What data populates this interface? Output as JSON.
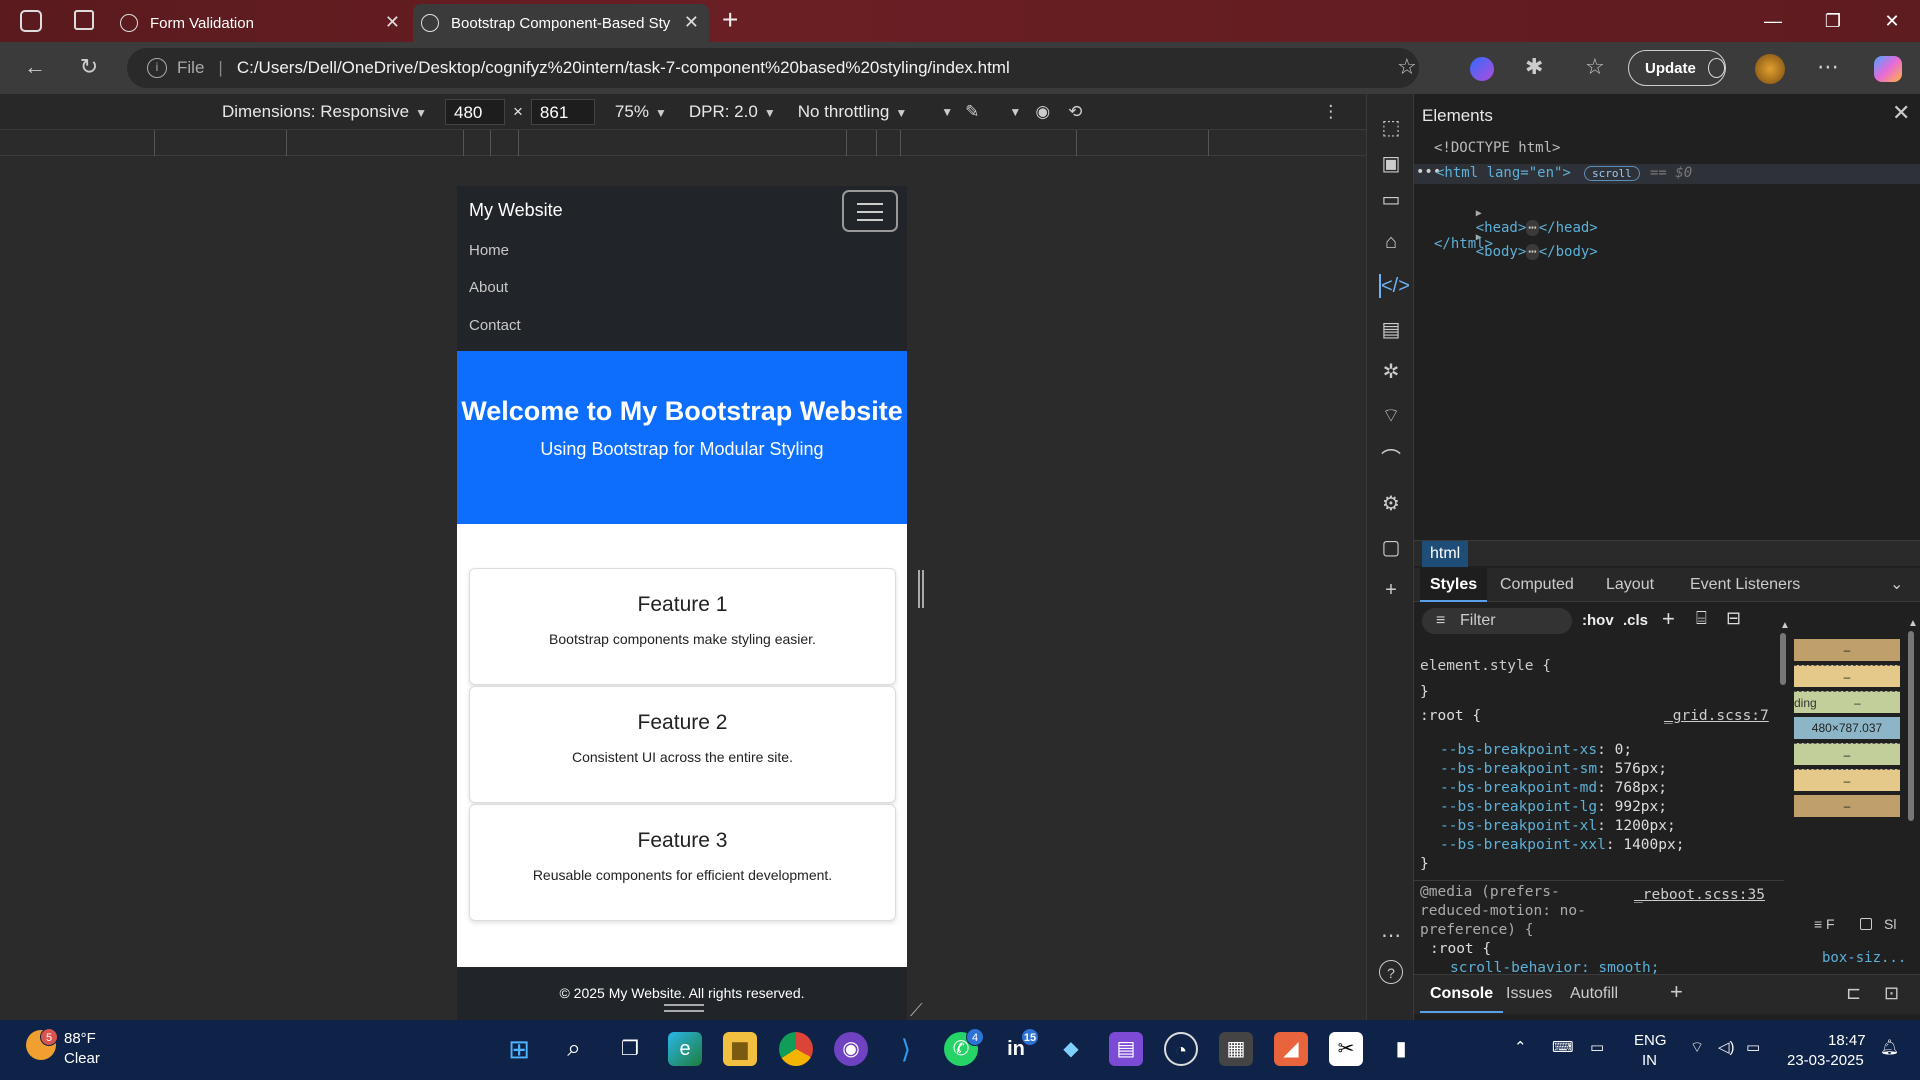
{
  "browser": {
    "tabs": [
      {
        "title": "Form Validation"
      },
      {
        "title": "Bootstrap Component-Based Styli"
      }
    ],
    "address": {
      "scheme_label": "File",
      "url": "C:/Users/Dell/OneDrive/Desktop/cognifyz%20intern/task-7-component%20based%20styling/index.html"
    },
    "update_label": "Update"
  },
  "device_toolbar": {
    "dimensions_label": "Dimensions: Responsive",
    "width": "480",
    "times": "×",
    "height": "861",
    "zoom": "75%",
    "dpr": "DPR: 2.0",
    "throttling": "No throttling"
  },
  "site": {
    "brand": "My Website",
    "nav": [
      "Home",
      "About",
      "Contact"
    ],
    "hero_title": "Welcome to My Bootstrap Website",
    "hero_subtitle": "Using Bootstrap for Modular Styling",
    "cards": [
      {
        "title": "Feature 1",
        "text": "Bootstrap components make styling easier."
      },
      {
        "title": "Feature 2",
        "text": "Consistent UI across the entire site."
      },
      {
        "title": "Feature 3",
        "text": "Reusable components for efficient development."
      }
    ],
    "footer": "© 2025 My Website. All rights reserved."
  },
  "devtools": {
    "panel_title": "Elements",
    "dom": {
      "doctype": "<!DOCTYPE html>",
      "html_open": "<html lang=\"en\">",
      "scroll_badge": "scroll",
      "dollar0": "== $0",
      "head": "<head>",
      "head_close": "</head>",
      "body": "<body>",
      "body_close": "</body>",
      "html_close": "</html>"
    },
    "breadcrumb": "html",
    "style_tabs": [
      "Styles",
      "Computed",
      "Layout",
      "Event Listeners"
    ],
    "filter_placeholder": "Filter",
    "hov": ":hov",
    "cls": ".cls",
    "rules": {
      "element_style": "element.style {",
      "close": "}",
      "root_selector": ":root {",
      "root_source": "_grid.scss:7",
      "vars": [
        {
          "name": "--bs-breakpoint-xs",
          "value": "0;"
        },
        {
          "name": "--bs-breakpoint-sm",
          "value": "576px;"
        },
        {
          "name": "--bs-breakpoint-md",
          "value": "768px;"
        },
        {
          "name": "--bs-breakpoint-lg",
          "value": "992px;"
        },
        {
          "name": "--bs-breakpoint-xl",
          "value": "1200px;"
        },
        {
          "name": "--bs-breakpoint-xxl",
          "value": "1400px;"
        }
      ],
      "media_line1": "@media (prefers-",
      "media_line2": "reduced-motion: no-",
      "media_line3": "preference) {",
      "media_source": "_reboot.scss:35",
      "media_root": ":root {",
      "scroll_behavior": "scroll-behavior: smooth;"
    },
    "boxmodel": {
      "dash": "–",
      "padding_label": "ding",
      "content_size": "480×787.037",
      "box_sizing": "box-siz...",
      "sh": "Sl"
    },
    "drawer_tabs": [
      "Console",
      "Issues",
      "Autofill"
    ]
  },
  "taskbar": {
    "weather_temp": "88°F",
    "weather_cond": "Clear",
    "weather_badge": "5",
    "badges": {
      "whatsapp": "4",
      "linkedin": "15"
    },
    "lang": "ENG",
    "region": "IN",
    "time": "18:47",
    "date": "23-03-2025"
  },
  "colors": {
    "hero_blue": "#0d6efd",
    "navbar_dark": "#212529",
    "tabbar": "#5a1a1e",
    "taskbar": "#0f2349",
    "boxmodel_padding": "#c0a06a",
    "boxmodel_content": "#8cb6c8"
  }
}
